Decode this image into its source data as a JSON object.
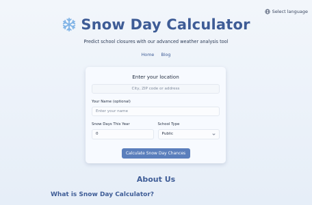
{
  "header": {
    "language_label": "Select language",
    "title": "Snow Day Calculator",
    "title_icon": "snowflake-icon",
    "subtitle": "Predict school closures with our advanced weather analysis tool"
  },
  "nav": {
    "items": [
      {
        "label": "Home"
      },
      {
        "label": "Blog"
      }
    ]
  },
  "form": {
    "heading": "Enter your location",
    "location_placeholder": "City, ZIP code or address",
    "name_label": "Your Name (optional)",
    "name_placeholder": "Enter your name",
    "snow_days_label": "Snow Days This Year",
    "snow_days_value": "0",
    "school_type_label": "School Type",
    "school_type_value": "Public",
    "submit_label": "Calculate Snow Day Chances"
  },
  "about": {
    "title": "About Us",
    "subtitle": "What is Snow Day Calculator?"
  },
  "colors": {
    "accent": "#3e5c96",
    "button": "#5b7fbc"
  }
}
